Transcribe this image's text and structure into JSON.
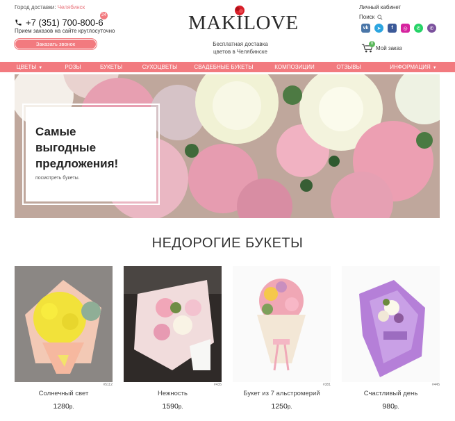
{
  "header": {
    "delivery_label": "Город доставки:",
    "delivery_city": "Челябинск",
    "phone": "+7 (351) 700-800-6",
    "phone_badge": "24",
    "phone_note": "Прием заказов на сайте круглосуточно",
    "callback_button": "Заказать звонок",
    "logo": "MAKILOVE",
    "tagline": "Бесплатная доставка цветов в Челябинске",
    "cabinet_link": "Личный кабинет",
    "search_label": "Поиск",
    "socials": [
      {
        "name": "vk",
        "label": "vk",
        "color": "#4a76a8"
      },
      {
        "name": "telegram",
        "label": "➤",
        "color": "#2ca5e0"
      },
      {
        "name": "facebook",
        "label": "f",
        "color": "#3b5998"
      },
      {
        "name": "instagram",
        "label": "◎",
        "color": "#d6249f"
      },
      {
        "name": "whatsapp",
        "label": "✆",
        "color": "#25d366"
      },
      {
        "name": "viber",
        "label": "✆",
        "color": "#7b519d"
      }
    ],
    "cart_label": "Мой заказ",
    "cart_count": "0"
  },
  "nav": [
    {
      "label": "ЦВЕТЫ",
      "dropdown": true
    },
    {
      "label": "РОЗЫ",
      "dropdown": false
    },
    {
      "label": "БУКЕТЫ",
      "dropdown": false
    },
    {
      "label": "СУХОЦВЕТЫ",
      "dropdown": false
    },
    {
      "label": "СВАДЕБНЫЕ БУКЕТЫ",
      "dropdown": false
    },
    {
      "label": "КОМПОЗИЦИИ",
      "dropdown": false
    },
    {
      "label": "ОТЗЫВЫ",
      "dropdown": false
    },
    {
      "label": "ИНФОРМАЦИЯ",
      "dropdown": true
    }
  ],
  "hero": {
    "title_line1": "Самые",
    "title_line2": "выгодные",
    "title_line3": "предложения!",
    "link": "посмотреть букеты."
  },
  "section_title": "НЕДОРОГИЕ БУКЕТЫ",
  "products": [
    {
      "name": "Солнечный свет",
      "price": "1280",
      "currency": "р.",
      "sku": "#5112"
    },
    {
      "name": "Нежность",
      "price": "1590",
      "currency": "р.",
      "sku": "#435"
    },
    {
      "name": "Букет из 7 альстромерий",
      "price": "1250",
      "currency": "р.",
      "sku": "#381"
    },
    {
      "name": "Счастливый день",
      "price": "980",
      "currency": "р.",
      "sku": "#445"
    }
  ],
  "colors": {
    "accent": "#f27a7f",
    "nav_bg": "#f27a7f",
    "city_link": "#e8747c"
  }
}
